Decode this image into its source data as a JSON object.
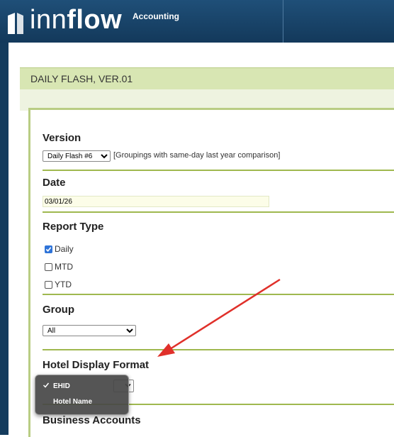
{
  "header": {
    "logo_text_thin": "inn",
    "logo_text_bold": "flow",
    "app_name": "Accounting"
  },
  "page": {
    "title": "DAILY FLASH, VER.01"
  },
  "form": {
    "version": {
      "label": "Version",
      "selected": "Daily Flash #6",
      "note": "[Groupings with same-day last year comparison]"
    },
    "date": {
      "label": "Date",
      "value": "03/01/26"
    },
    "report_type": {
      "label": "Report Type",
      "options": [
        {
          "label": "Daily",
          "checked": true
        },
        {
          "label": "MTD",
          "checked": false
        },
        {
          "label": "YTD",
          "checked": false
        }
      ]
    },
    "group": {
      "label": "Group",
      "selected": "All"
    },
    "hotel_display_format": {
      "label": "Hotel Display Format",
      "menu_options": [
        {
          "label": "EHID",
          "selected": true
        },
        {
          "label": "Hotel Name",
          "selected": false
        }
      ]
    },
    "business_accounts": {
      "label": "Business Accounts"
    }
  },
  "colors": {
    "header_bg": "#13395b",
    "section_green": "#9fb84f",
    "title_bar_bg": "#d8e6b3",
    "annotation_arrow": "#e0302a",
    "checkbox_checked": "#2f74d8"
  }
}
